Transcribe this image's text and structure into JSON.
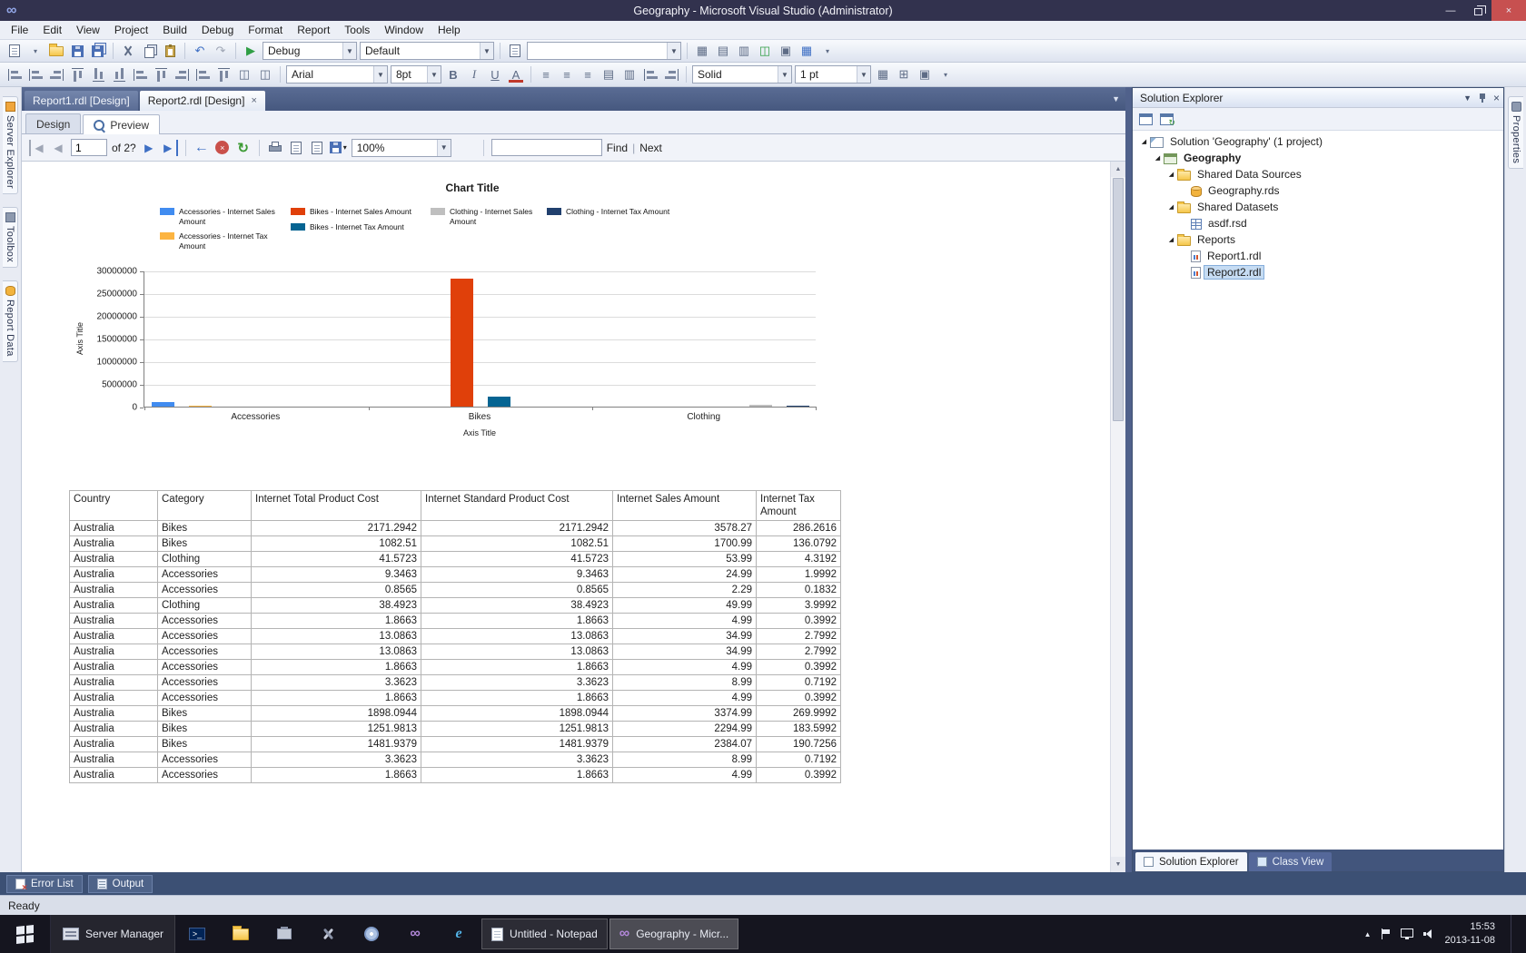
{
  "titlebar": {
    "title": "Geography - Microsoft Visual Studio (Administrator)"
  },
  "menus": [
    "File",
    "Edit",
    "View",
    "Project",
    "Build",
    "Debug",
    "Format",
    "Report",
    "Tools",
    "Window",
    "Help"
  ],
  "toolbar": {
    "config": "Debug",
    "platform": "Default",
    "font_name": "Arial",
    "font_size": "8pt",
    "border_style": "Solid",
    "border_width": "1 pt"
  },
  "left_tool_tabs": [
    {
      "label": "Server Explorer",
      "icon": "server-explorer"
    },
    {
      "label": "Toolbox",
      "icon": "toolbox"
    },
    {
      "label": "Report Data",
      "icon": "report-data"
    }
  ],
  "right_tool_tabs": [
    {
      "label": "Properties",
      "icon": "properties"
    }
  ],
  "document_tabs": [
    {
      "label": "Report1.rdl [Design]",
      "active": false
    },
    {
      "label": "Report2.rdl [Design]",
      "active": true
    }
  ],
  "view_tabs": [
    {
      "label": "Design",
      "active": false
    },
    {
      "label": "Preview",
      "active": true
    }
  ],
  "preview_toolbar": {
    "page_number": "1",
    "of_label": "of 2?",
    "zoom": "100%",
    "find_value": "",
    "find_label": "Find",
    "next_label": "Next"
  },
  "chart_data": {
    "type": "bar",
    "title": "Chart Title",
    "x_axis_title": "Axis Title",
    "y_axis_title": "Axis Title",
    "categories": [
      "Accessories",
      "Bikes",
      "Clothing"
    ],
    "series": [
      {
        "name": "Accessories - Internet Sales Amount",
        "color": "#418CF0",
        "values": [
          900000,
          0,
          0
        ]
      },
      {
        "name": "Accessories - Internet Tax Amount",
        "color": "#FCB441",
        "values": [
          72000,
          0,
          0
        ]
      },
      {
        "name": "Bikes - Internet Sales Amount",
        "color": "#E0400A",
        "values": [
          0,
          28200000,
          0
        ]
      },
      {
        "name": "Bikes - Internet Tax Amount",
        "color": "#056492",
        "values": [
          0,
          2256000,
          0
        ]
      },
      {
        "name": "Clothing - Internet Sales Amount",
        "color": "#BFBFBF",
        "values": [
          0,
          0,
          330000
        ]
      },
      {
        "name": "Clothing - Internet Tax Amount",
        "color": "#21406E",
        "values": [
          0,
          0,
          26400
        ]
      }
    ],
    "ylim": [
      0,
      30000000
    ],
    "y_tick_step": 5000000,
    "legend_position": "top",
    "grid": true
  },
  "table": {
    "columns": [
      "Country",
      "Category",
      "Internet Total Product Cost",
      "Internet Standard Product Cost",
      "Internet Sales Amount",
      "Internet Tax Amount"
    ],
    "rows": [
      [
        "Australia",
        "Bikes",
        "2171.2942",
        "2171.2942",
        "3578.27",
        "286.2616"
      ],
      [
        "Australia",
        "Bikes",
        "1082.51",
        "1082.51",
        "1700.99",
        "136.0792"
      ],
      [
        "Australia",
        "Clothing",
        "41.5723",
        "41.5723",
        "53.99",
        "4.3192"
      ],
      [
        "Australia",
        "Accessories",
        "9.3463",
        "9.3463",
        "24.99",
        "1.9992"
      ],
      [
        "Australia",
        "Accessories",
        "0.8565",
        "0.8565",
        "2.29",
        "0.1832"
      ],
      [
        "Australia",
        "Clothing",
        "38.4923",
        "38.4923",
        "49.99",
        "3.9992"
      ],
      [
        "Australia",
        "Accessories",
        "1.8663",
        "1.8663",
        "4.99",
        "0.3992"
      ],
      [
        "Australia",
        "Accessories",
        "13.0863",
        "13.0863",
        "34.99",
        "2.7992"
      ],
      [
        "Australia",
        "Accessories",
        "13.0863",
        "13.0863",
        "34.99",
        "2.7992"
      ],
      [
        "Australia",
        "Accessories",
        "1.8663",
        "1.8663",
        "4.99",
        "0.3992"
      ],
      [
        "Australia",
        "Accessories",
        "3.3623",
        "3.3623",
        "8.99",
        "0.7192"
      ],
      [
        "Australia",
        "Accessories",
        "1.8663",
        "1.8663",
        "4.99",
        "0.3992"
      ],
      [
        "Australia",
        "Bikes",
        "1898.0944",
        "1898.0944",
        "3374.99",
        "269.9992"
      ],
      [
        "Australia",
        "Bikes",
        "1251.9813",
        "1251.9813",
        "2294.99",
        "183.5992"
      ],
      [
        "Australia",
        "Bikes",
        "1481.9379",
        "1481.9379",
        "2384.07",
        "190.7256"
      ],
      [
        "Australia",
        "Accessories",
        "3.3623",
        "3.3623",
        "8.99",
        "0.7192"
      ],
      [
        "Australia",
        "Accessories",
        "1.8663",
        "1.8663",
        "4.99",
        "0.3992"
      ]
    ]
  },
  "solution_explorer": {
    "title": "Solution Explorer",
    "tree": [
      {
        "label": "Solution 'Geography' (1 project)",
        "level": 0,
        "icon": "solution",
        "expanded": true
      },
      {
        "label": "Geography",
        "level": 1,
        "icon": "project",
        "bold": true,
        "expanded": true
      },
      {
        "label": "Shared Data Sources",
        "level": 2,
        "icon": "folder",
        "expanded": true
      },
      {
        "label": "Geography.rds",
        "level": 3,
        "icon": "datasource"
      },
      {
        "label": "Shared Datasets",
        "level": 2,
        "icon": "folder",
        "expanded": true
      },
      {
        "label": "asdf.rsd",
        "level": 3,
        "icon": "dataset"
      },
      {
        "label": "Reports",
        "level": 2,
        "icon": "folder",
        "expanded": true
      },
      {
        "label": "Report1.rdl",
        "level": 3,
        "icon": "report"
      },
      {
        "label": "Report2.rdl",
        "level": 3,
        "icon": "report",
        "selected": true
      }
    ],
    "bottom_tabs": [
      {
        "label": "Solution Explorer",
        "active": true
      },
      {
        "label": "Class View",
        "active": false
      }
    ]
  },
  "bottom_panel": {
    "tabs": [
      {
        "label": "Error List",
        "icon": "error-list"
      },
      {
        "label": "Output",
        "icon": "output"
      }
    ]
  },
  "status": {
    "text": "Ready"
  },
  "taskbar": {
    "server_manager": "Server Manager",
    "windows": [
      {
        "label": "Untitled - Notepad",
        "icon": "notepad",
        "active": false
      },
      {
        "label": "Geography - Micr...",
        "icon": "visual-studio",
        "active": true
      }
    ],
    "clock": {
      "time": "15:53",
      "date": "2013-11-08"
    }
  }
}
